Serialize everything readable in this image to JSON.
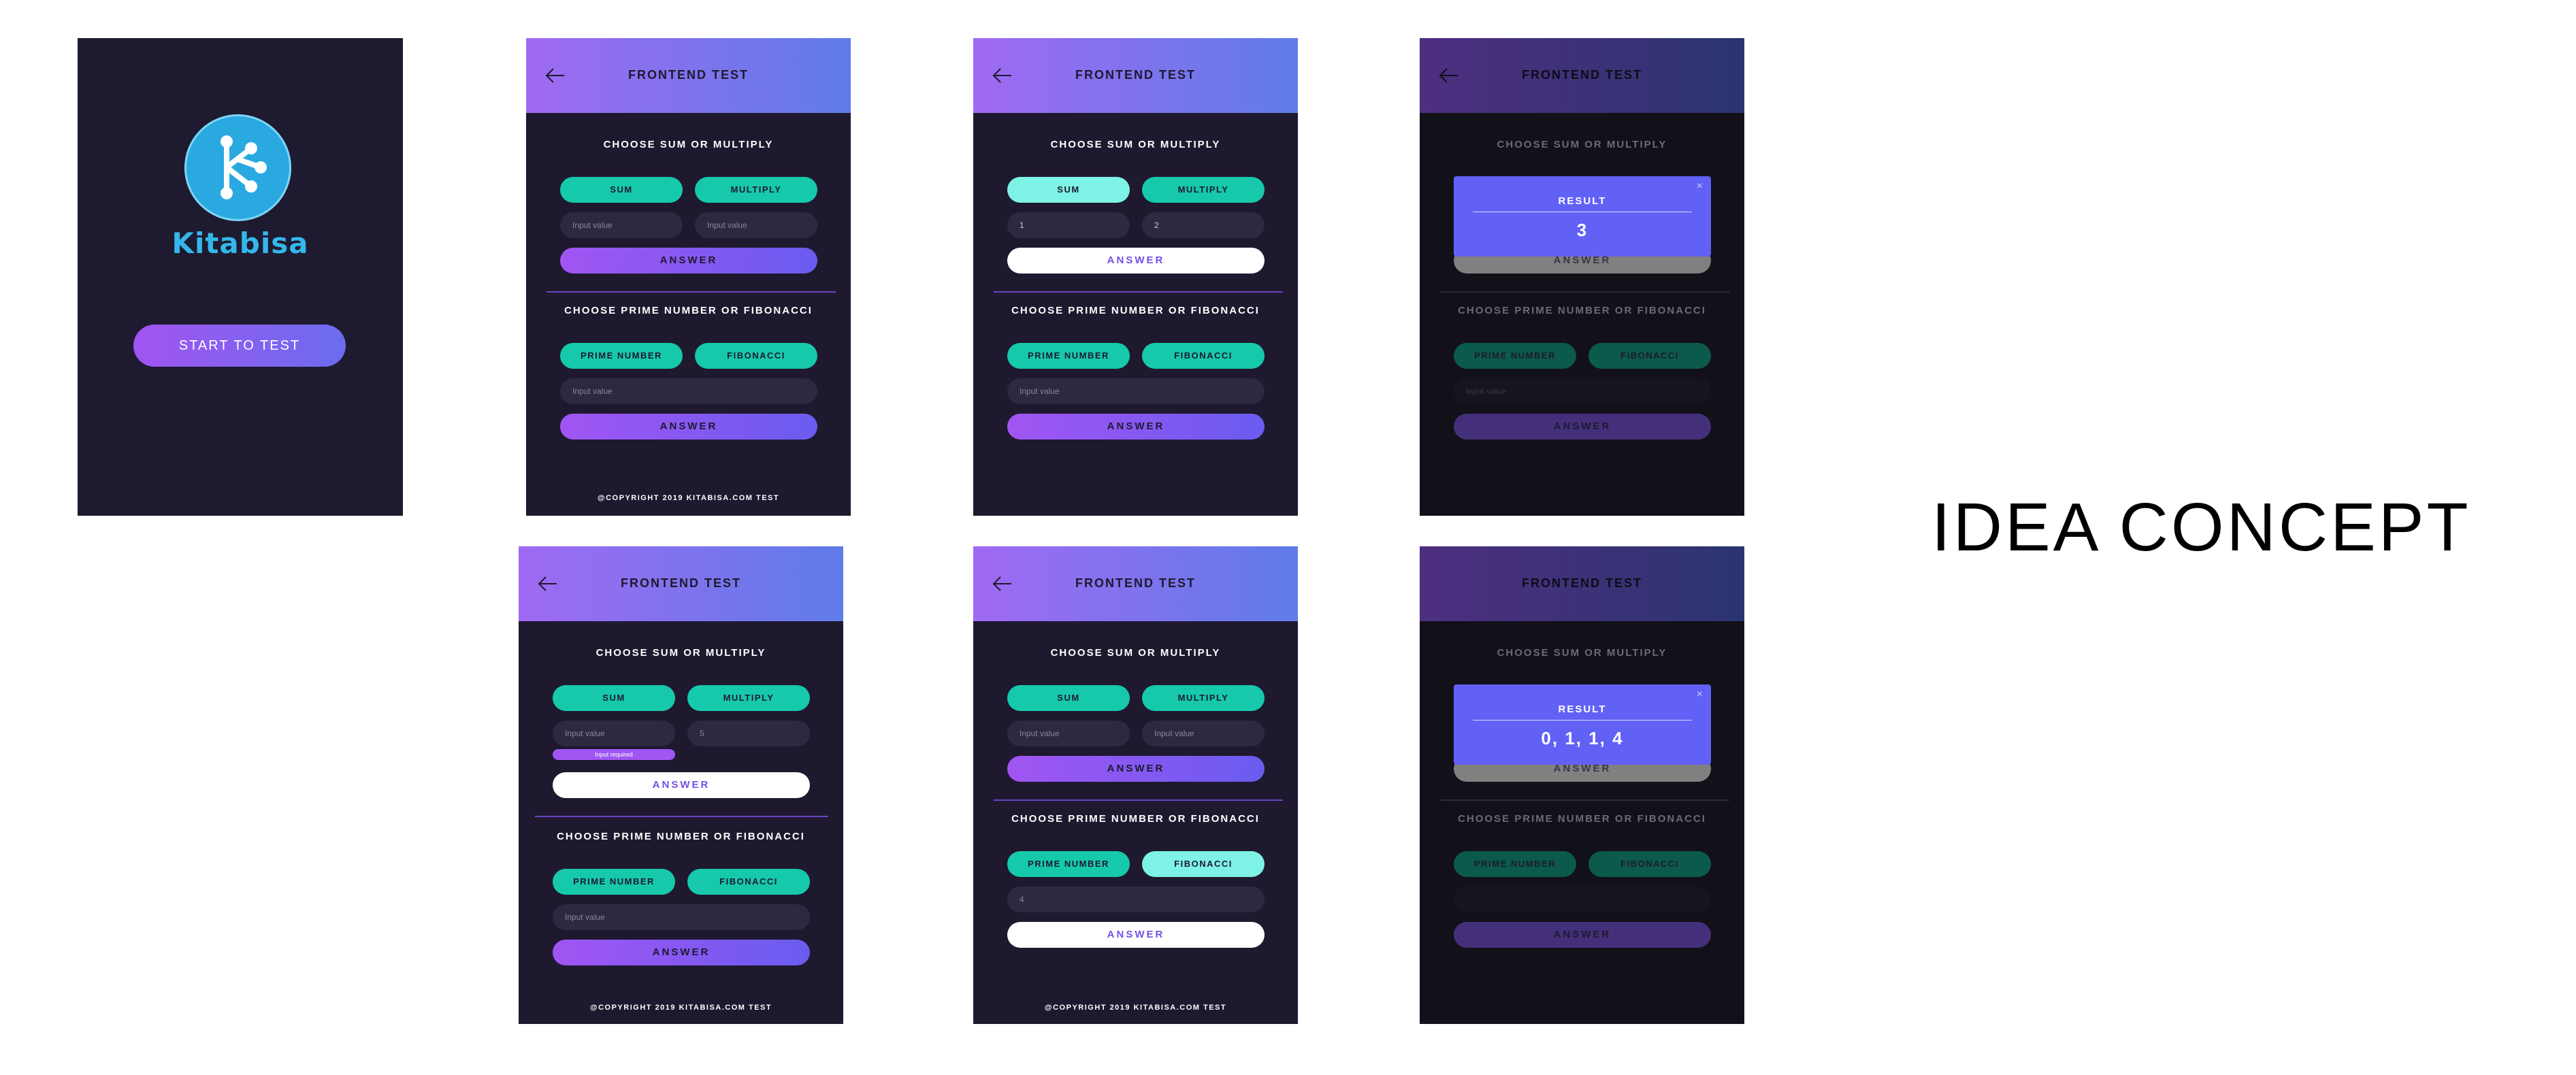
{
  "splash": {
    "logo_name": "Kitabisa",
    "start_button": "START TO TEST"
  },
  "app": {
    "header_title": "FRONTEND TEST",
    "section_sum_title": "CHOOSE SUM OR MULTIPLY",
    "section_prime_title": "CHOOSE PRIME NUMBER OR FIBONACCI",
    "sum_label": "SUM",
    "multiply_label": "MULTIPLY",
    "prime_label": "PRIME NUMBER",
    "fibonacci_label": "FIBONACCI",
    "answer_label": "ANSWER",
    "input_placeholder": "Input value",
    "footer": "@COPYRIGHT 2019 KITABISA.COM TEST",
    "result_title": "RESULT",
    "close_glyph": "×"
  },
  "screen3": {
    "input_a": "1",
    "input_b": "2"
  },
  "screen4": {
    "result_value": "3"
  },
  "screen5": {
    "input_b": "5",
    "error_text": "Input required"
  },
  "screen6": {
    "fib_input": "4"
  },
  "screen7": {
    "result_value": "0, 1, 1, 4"
  },
  "caption": "IDEA CONCEPT",
  "colors": {
    "primary_purple": "#a155f2",
    "accent_teal": "#16c9ab",
    "background": "#1e192f",
    "modal": "#6161f5"
  }
}
